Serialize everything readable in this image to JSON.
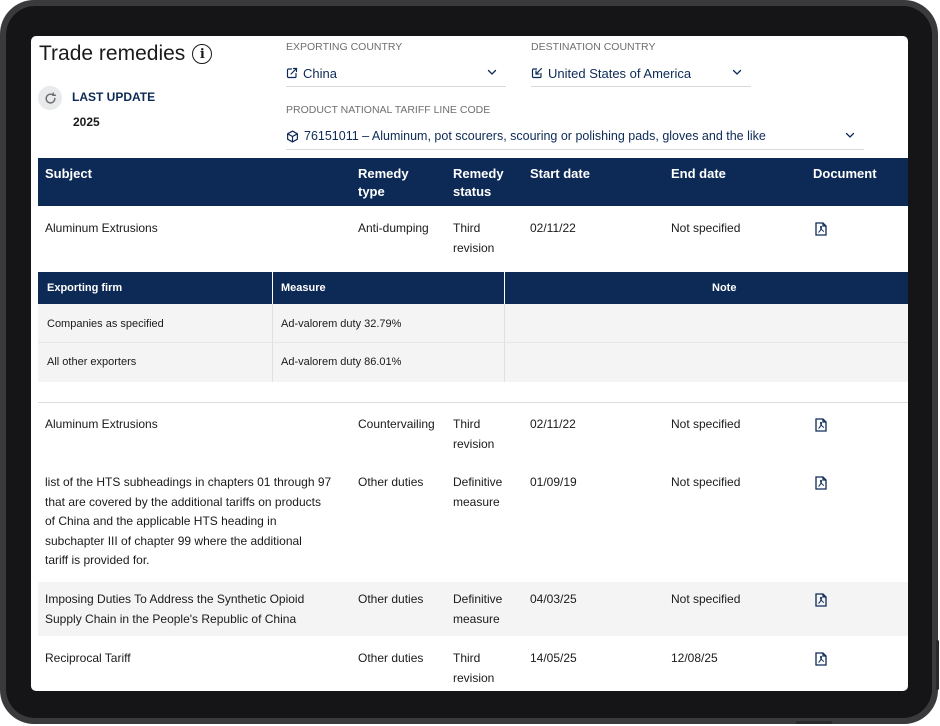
{
  "page": {
    "title": "Trade remedies",
    "last_update_label": "LAST UPDATE",
    "last_update_value": "2025"
  },
  "filters": {
    "exporting_country": {
      "label": "EXPORTING COUNTRY",
      "value": "China"
    },
    "destination_country": {
      "label": "DESTINATION COUNTRY",
      "value": "United States of America"
    },
    "product_code": {
      "label": "PRODUCT NATIONAL TARIFF LINE CODE",
      "value": "76151011 – Aluminum, pot scourers, scouring or polishing pads, gloves and the like"
    }
  },
  "table": {
    "headers": {
      "subject": "Subject",
      "remedy_type_1": "Remedy",
      "remedy_type_2": "type",
      "remedy_status_1": "Remedy",
      "remedy_status_2": "status",
      "start_date": "Start date",
      "end_date": "End date",
      "document": "Document"
    },
    "rows": [
      {
        "subject": [
          "Aluminum Extrusions"
        ],
        "type": "Anti-dumping",
        "status": [
          "Third",
          "revision"
        ],
        "start": "02/11/22",
        "end": "Not specified"
      },
      {
        "subject": [
          "Aluminum Extrusions"
        ],
        "type": "Countervailing",
        "status": [
          "Third",
          "revision"
        ],
        "start": "02/11/22",
        "end": "Not specified"
      },
      {
        "subject": [
          "list of the HTS subheadings in chapters 01 through 97",
          "that are covered by the additional tariffs on products",
          "of China and the applicable HTS heading in",
          "subchapter III of chapter 99 where the additional",
          "tariff is provided for."
        ],
        "type": "Other duties",
        "status": [
          "Definitive",
          "measure"
        ],
        "start": "01/09/19",
        "end": "Not specified"
      },
      {
        "subject": [
          "Imposing Duties To Address the Synthetic Opioid",
          "Supply Chain in the People's Republic of China"
        ],
        "type": "Other duties",
        "status": [
          "Definitive",
          "measure"
        ],
        "start": "04/03/25",
        "end": "Not specified"
      },
      {
        "subject": [
          "Reciprocal Tariff"
        ],
        "type": "Other duties",
        "status": [
          "Third",
          "revision"
        ],
        "start": "14/05/25",
        "end": "12/08/25"
      }
    ]
  },
  "measures": {
    "headers": {
      "firm": "Exporting firm",
      "measure": "Measure",
      "note": "Note"
    },
    "rows": [
      {
        "firm": "Companies as specified",
        "measure": "Ad-valorem duty 32.79%",
        "note": ""
      },
      {
        "firm": "All other exporters",
        "measure": "Ad-valorem duty 86.01%",
        "note": ""
      }
    ]
  },
  "colors": {
    "navy": "#0d2a57",
    "band": "#f4f4f4",
    "frame": "#3a3a3c"
  },
  "icons": {
    "info": "info-icon",
    "refresh": "refresh-icon",
    "exporting": "arrow-out-icon",
    "destination": "arrow-in-icon",
    "product": "box-icon",
    "chevron": "chevron-down-icon",
    "document": "pdf-icon"
  }
}
